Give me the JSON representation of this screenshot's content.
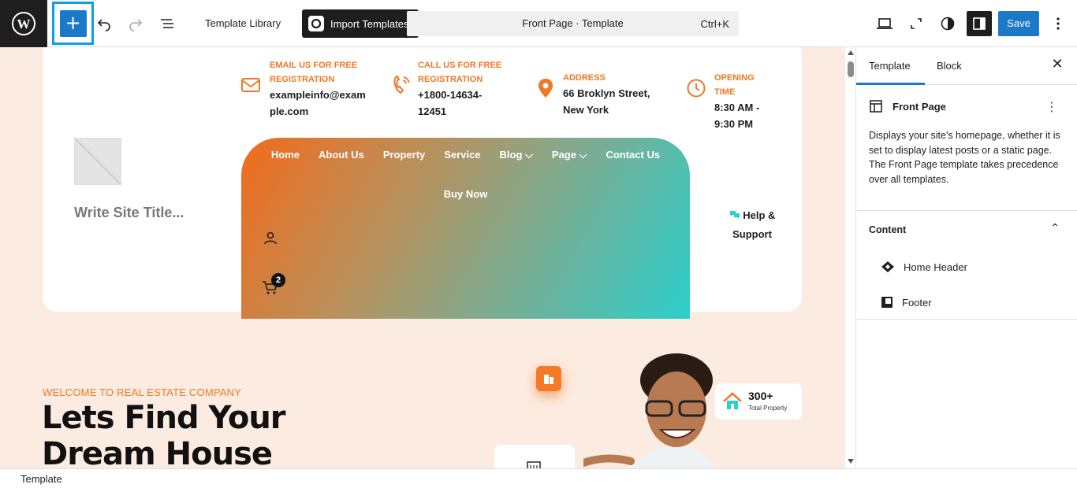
{
  "toolbar": {
    "template_library": "Template Library",
    "import_templates": "Import Templates",
    "doc_title": "Front Page · Template",
    "shortcut": "Ctrl+K",
    "save": "Save"
  },
  "colors": {
    "accent": "#1b79c7",
    "brand_orange": "#f07826",
    "canvas_bg": "#fcebe0"
  },
  "canvas": {
    "contacts": [
      {
        "label": "EMAIL US FOR FREE REGISTRATION",
        "value": "exampleinfo@example.com",
        "icon": "mail-icon"
      },
      {
        "label": "CALL US FOR FREE REGISTRATION",
        "value": "+1800-14634-12451",
        "icon": "phone-icon"
      },
      {
        "label": "ADDRESS",
        "value": "66 Broklyn Street, New York",
        "icon": "location-pin-icon"
      },
      {
        "label": "OPENING TIME",
        "value": "8:30 AM - 9:30 PM",
        "icon": "clock-icon"
      }
    ],
    "site_title": "Write Site Title...",
    "menu": [
      "Home",
      "About Us",
      "Property",
      "Service",
      "Blog ⌵",
      "Page ⌵",
      "Contact Us"
    ],
    "buy_now": "Buy Now",
    "cart_count": "2",
    "help_line1": "Help &",
    "help_line2": "Support",
    "welcome": "WELCOME TO REAL ESTATE COMPANY",
    "headline_1": "Lets Find Your",
    "headline_2": "Dream House",
    "stat_value": "300+",
    "stat_label": "Total Property"
  },
  "sidebar": {
    "tabs": [
      "Template",
      "Block"
    ],
    "template_name": "Front Page",
    "description": "Displays your site's homepage, whether it is set to display latest posts or a static page. The Front Page template takes precedence over all templates.",
    "content_title": "Content",
    "content_items": [
      "Home Header",
      "Footer"
    ]
  },
  "footer": {
    "breadcrumb": "Template"
  }
}
